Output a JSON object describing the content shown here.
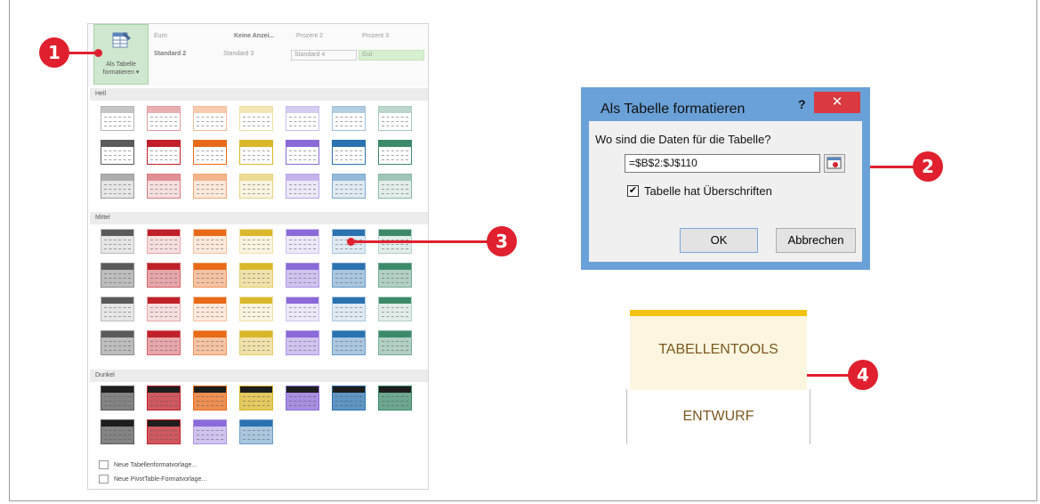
{
  "markers": [
    "1",
    "2",
    "3",
    "4"
  ],
  "ribbon": {
    "button_label": "Als Tabelle formatieren",
    "button_dropdown": "▾",
    "styles": [
      "Euro",
      "Keine Anzei...",
      "Prozent 2",
      "Prozent 3",
      "Standard 2",
      "Standard 3",
      "Standard 4",
      "Gut"
    ]
  },
  "gallery": {
    "sections": [
      "Hell",
      "Mittel",
      "Dunkel"
    ],
    "footer": [
      "Neue Tabellenformatvorlage...",
      "Neue PivotTable-Formatvorlage..."
    ]
  },
  "dialog": {
    "title": "Als Tabelle formatieren",
    "help": "?",
    "close": "✕",
    "question": "Wo sind die Daten für die Tabelle?",
    "range": "=$B$2:$J$110",
    "checkbox_checked": true,
    "checkbox_label": "Tabelle hat Überschriften",
    "ok": "OK",
    "cancel": "Abbrechen"
  },
  "contextual": {
    "group": "TABELLENTOOLS",
    "tab": "ENTWURF"
  },
  "colors": {
    "accent_red": "#e0202e",
    "dialog_border": "#6aa1d8",
    "tools_yellow": "#f2c312",
    "palette": [
      "#5a5a5a",
      "#c0202a",
      "#e86a18",
      "#d9b72a",
      "#8a6ad8",
      "#2a72b0",
      "#3c8a6a"
    ]
  }
}
